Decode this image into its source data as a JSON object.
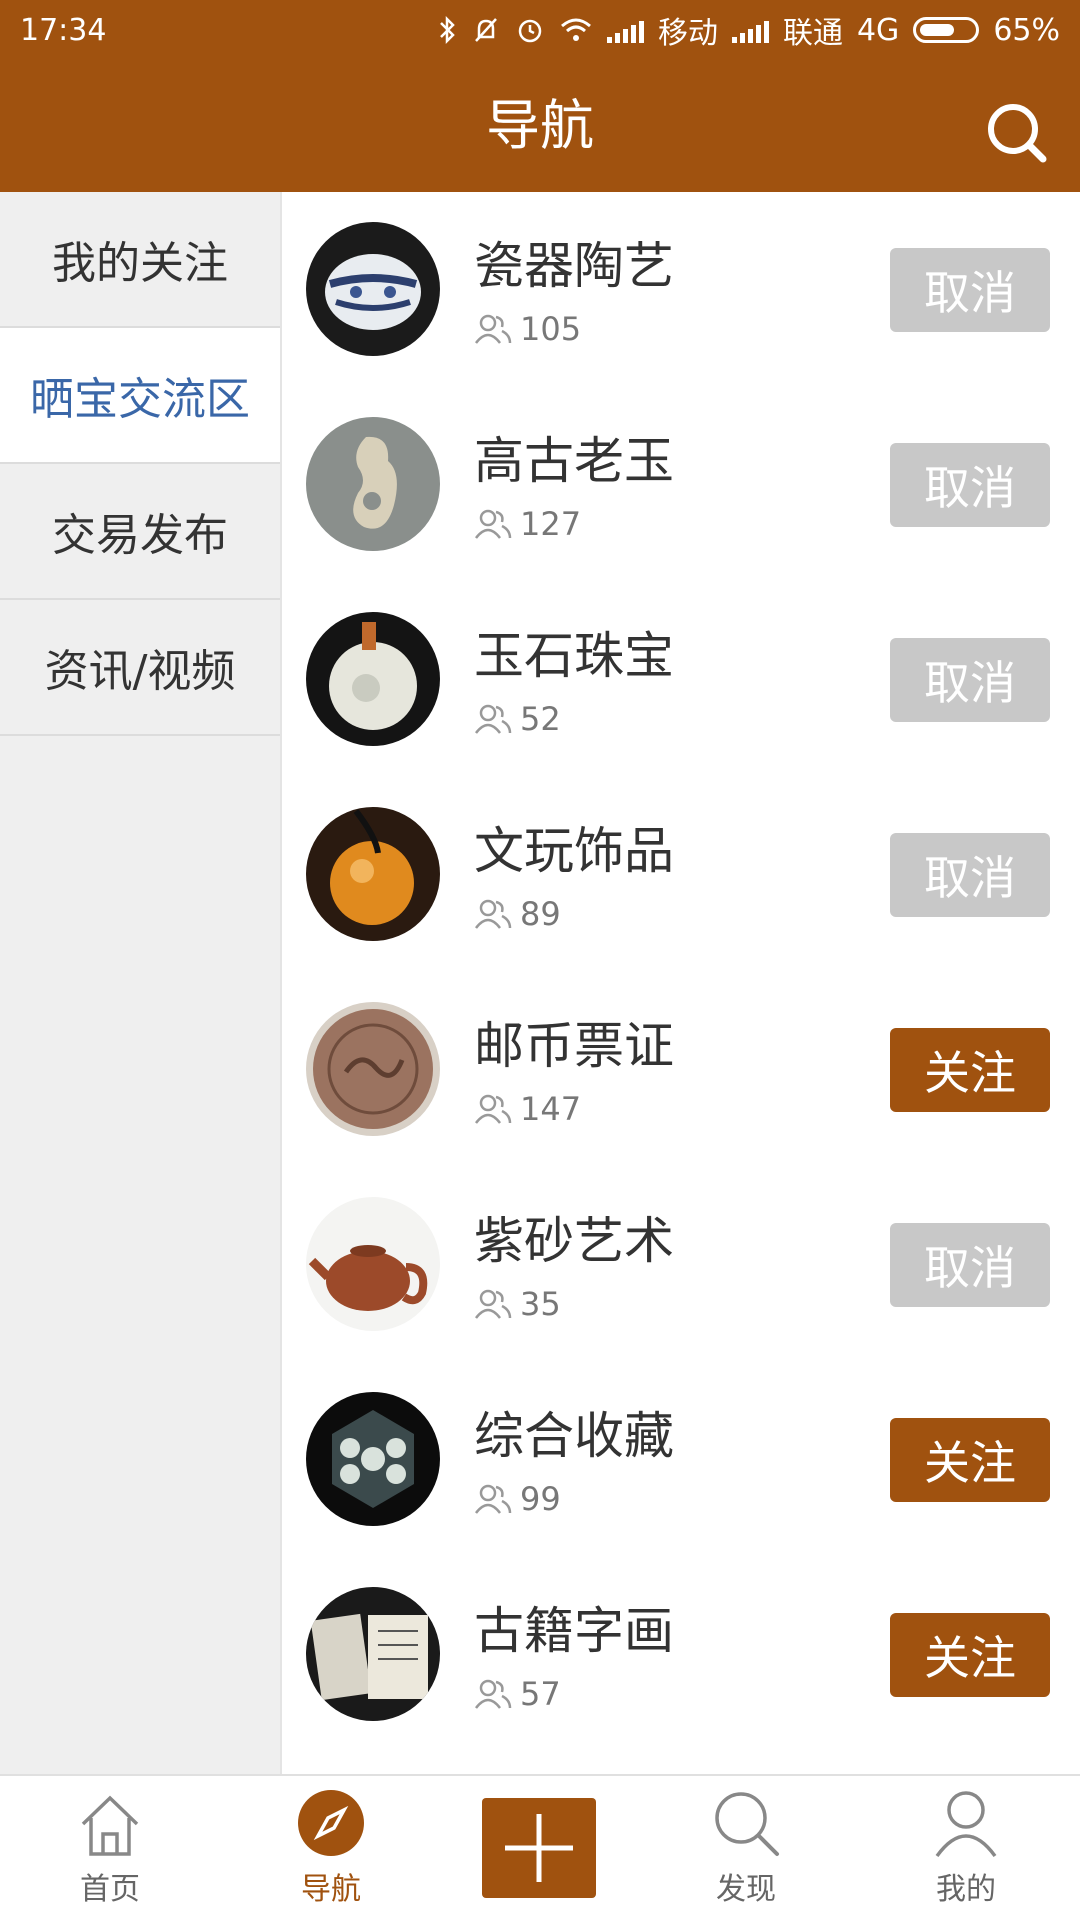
{
  "status_bar": {
    "time": "17:34",
    "carrier1": "移动",
    "carrier2": "联通",
    "network": "4G",
    "battery": "65%",
    "battery_level": 0.65
  },
  "header": {
    "title": "导航",
    "search_icon": "search-icon"
  },
  "sidebar": {
    "items": [
      {
        "label": "我的关注",
        "active": false
      },
      {
        "label": "晒宝交流区",
        "active": true
      },
      {
        "label": "交易发布",
        "active": false
      },
      {
        "label": "资讯/视频",
        "active": false
      }
    ]
  },
  "categories": [
    {
      "name": "瓷器陶艺",
      "members": "105",
      "button": "取消",
      "following": true,
      "icon": "porcelain-jar-thumbnail"
    },
    {
      "name": "高古老玉",
      "members": "127",
      "button": "取消",
      "following": true,
      "icon": "jade-dragon-thumbnail"
    },
    {
      "name": "玉石珠宝",
      "members": "52",
      "button": "取消",
      "following": true,
      "icon": "jade-ring-thumbnail"
    },
    {
      "name": "文玩饰品",
      "members": "89",
      "button": "取消",
      "following": true,
      "icon": "amber-bead-thumbnail"
    },
    {
      "name": "邮币票证",
      "members": "147",
      "button": "关注",
      "following": false,
      "icon": "coin-thumbnail"
    },
    {
      "name": "紫砂艺术",
      "members": "35",
      "button": "取消",
      "following": true,
      "icon": "teapot-thumbnail"
    },
    {
      "name": "综合收藏",
      "members": "99",
      "button": "关注",
      "following": false,
      "icon": "collection-thumbnail"
    },
    {
      "name": "古籍字画",
      "members": "57",
      "button": "关注",
      "following": false,
      "icon": "books-thumbnail"
    }
  ],
  "tabbar": {
    "items": [
      {
        "label": "首页",
        "icon": "home-icon",
        "active": false
      },
      {
        "label": "导航",
        "icon": "compass-icon",
        "active": true
      },
      {
        "label": "",
        "icon": "plus-icon",
        "active": false
      },
      {
        "label": "发现",
        "icon": "search-icon",
        "active": false
      },
      {
        "label": "我的",
        "icon": "user-icon",
        "active": false
      }
    ]
  },
  "colors": {
    "brand": "#a0520f",
    "active_menu_text": "#3a67a8",
    "cancel_button": "#c8c8c8"
  }
}
